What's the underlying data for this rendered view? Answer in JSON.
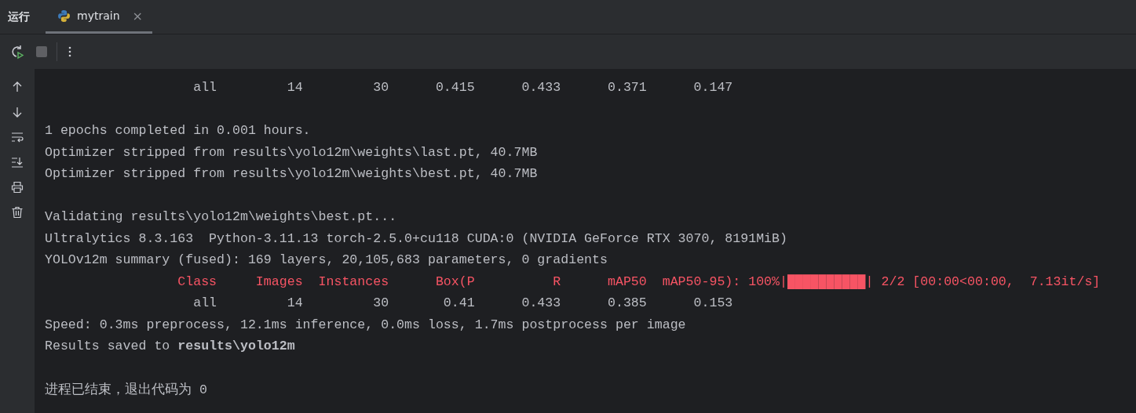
{
  "tool_window": {
    "title": "运行",
    "tabs": [
      {
        "label": "mytrain",
        "selected": true,
        "close": "×"
      }
    ]
  },
  "console": {
    "lines": [
      {
        "kind": "plain",
        "text": "                   all         14         30      0.415      0.433      0.371      0.147"
      },
      {
        "kind": "blank"
      },
      {
        "kind": "plain",
        "text": "1 epochs completed in 0.001 hours."
      },
      {
        "kind": "plain",
        "text": "Optimizer stripped from results\\yolo12m\\weights\\last.pt, 40.7MB"
      },
      {
        "kind": "plain",
        "text": "Optimizer stripped from results\\yolo12m\\weights\\best.pt, 40.7MB"
      },
      {
        "kind": "blank"
      },
      {
        "kind": "plain",
        "text": "Validating results\\yolo12m\\weights\\best.pt..."
      },
      {
        "kind": "plain",
        "text": "Ultralytics 8.3.163  Python-3.11.13 torch-2.5.0+cu118 CUDA:0 (NVIDIA GeForce RTX 3070, 8191MiB)"
      },
      {
        "kind": "plain",
        "text": "YOLOv12m summary (fused): 169 layers, 20,105,683 parameters, 0 gradients"
      },
      {
        "kind": "error",
        "text": "                 Class     Images  Instances      Box(P          R      mAP50  mAP50-95): 100%|██████████| 2/2 [00:00<00:00,  7.13it/s]"
      },
      {
        "kind": "plain",
        "text": "                   all         14         30       0.41      0.433      0.385      0.153"
      },
      {
        "kind": "plain",
        "text": "Speed: 0.3ms preprocess, 12.1ms inference, 0.0ms loss, 1.7ms postprocess per image"
      },
      {
        "kind": "plain",
        "text": "Results saved to **results\\yolo12m**"
      },
      {
        "kind": "blank"
      },
      {
        "kind": "plain",
        "text": "进程已结束，退出代码为 0"
      }
    ]
  }
}
